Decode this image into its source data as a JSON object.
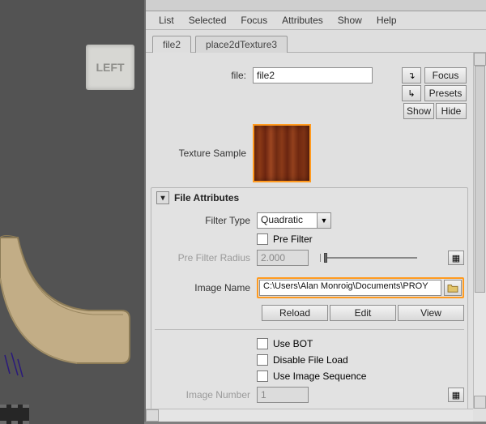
{
  "viewport": {
    "cube_label": "LEFT"
  },
  "menu": {
    "list": "List",
    "selected": "Selected",
    "focus": "Focus",
    "attributes": "Attributes",
    "show": "Show",
    "help": "Help"
  },
  "tabs": {
    "file": "file2",
    "place2d": "place2dTexture3"
  },
  "header": {
    "file_label": "file:",
    "file_value": "file2",
    "focus": "Focus",
    "presets": "Presets",
    "show": "Show",
    "hide": "Hide",
    "texture_sample": "Texture Sample"
  },
  "file_attributes": {
    "title": "File Attributes",
    "filter_type_label": "Filter Type",
    "filter_type_value": "Quadratic",
    "prefilter_label": "Pre Filter",
    "prefilter_radius_label": "Pre Filter Radius",
    "prefilter_radius_value": "2.000",
    "image_name_label": "Image Name",
    "image_name_value": "C:\\Users\\Alan Monroig\\Documents\\PROY",
    "reload": "Reload",
    "edit": "Edit",
    "view": "View",
    "use_bot": "Use BOT",
    "disable_file_load": "Disable File Load",
    "use_image_sequence": "Use Image Sequence",
    "image_number_label": "Image Number",
    "image_number_value": "1"
  },
  "icons": {
    "arrow_in": "↴",
    "arrow_out": "↳",
    "twisty": "▾",
    "dd": "▼"
  }
}
